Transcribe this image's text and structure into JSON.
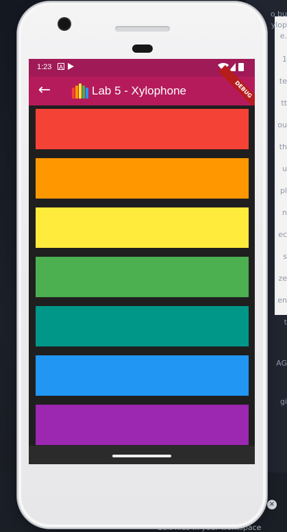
{
  "status_bar": {
    "time": "1:23",
    "icons": [
      "notification-a-icon",
      "play-store-icon",
      "wifi-icon",
      "signal-icon",
      "battery-icon"
    ]
  },
  "app_bar": {
    "back_icon": "arrow-left-icon",
    "title": "Lab 5 - Xylophone",
    "logo_icon": "xylophone-logo-icon",
    "badge": "DEBUG"
  },
  "xylophone": {
    "keys": [
      {
        "color": "#f44336"
      },
      {
        "color": "#ff9800"
      },
      {
        "color": "#ffeb3b"
      },
      {
        "color": "#4caf50"
      },
      {
        "color": "#009688"
      },
      {
        "color": "#2196f3"
      },
      {
        "color": "#9c27b0"
      }
    ]
  },
  "background": {
    "right_snippets": [
      "o bu",
      "ylop",
      "e.",
      "1",
      "te",
      "tt",
      "ou",
      "th",
      "u",
      "pl",
      "n",
      "ec",
      "s",
      "ze",
      "en",
      "t",
      "AG",
      "gi"
    ],
    "bottom_hint": "Edit files in your workspace",
    "close_icon": "close-icon"
  }
}
